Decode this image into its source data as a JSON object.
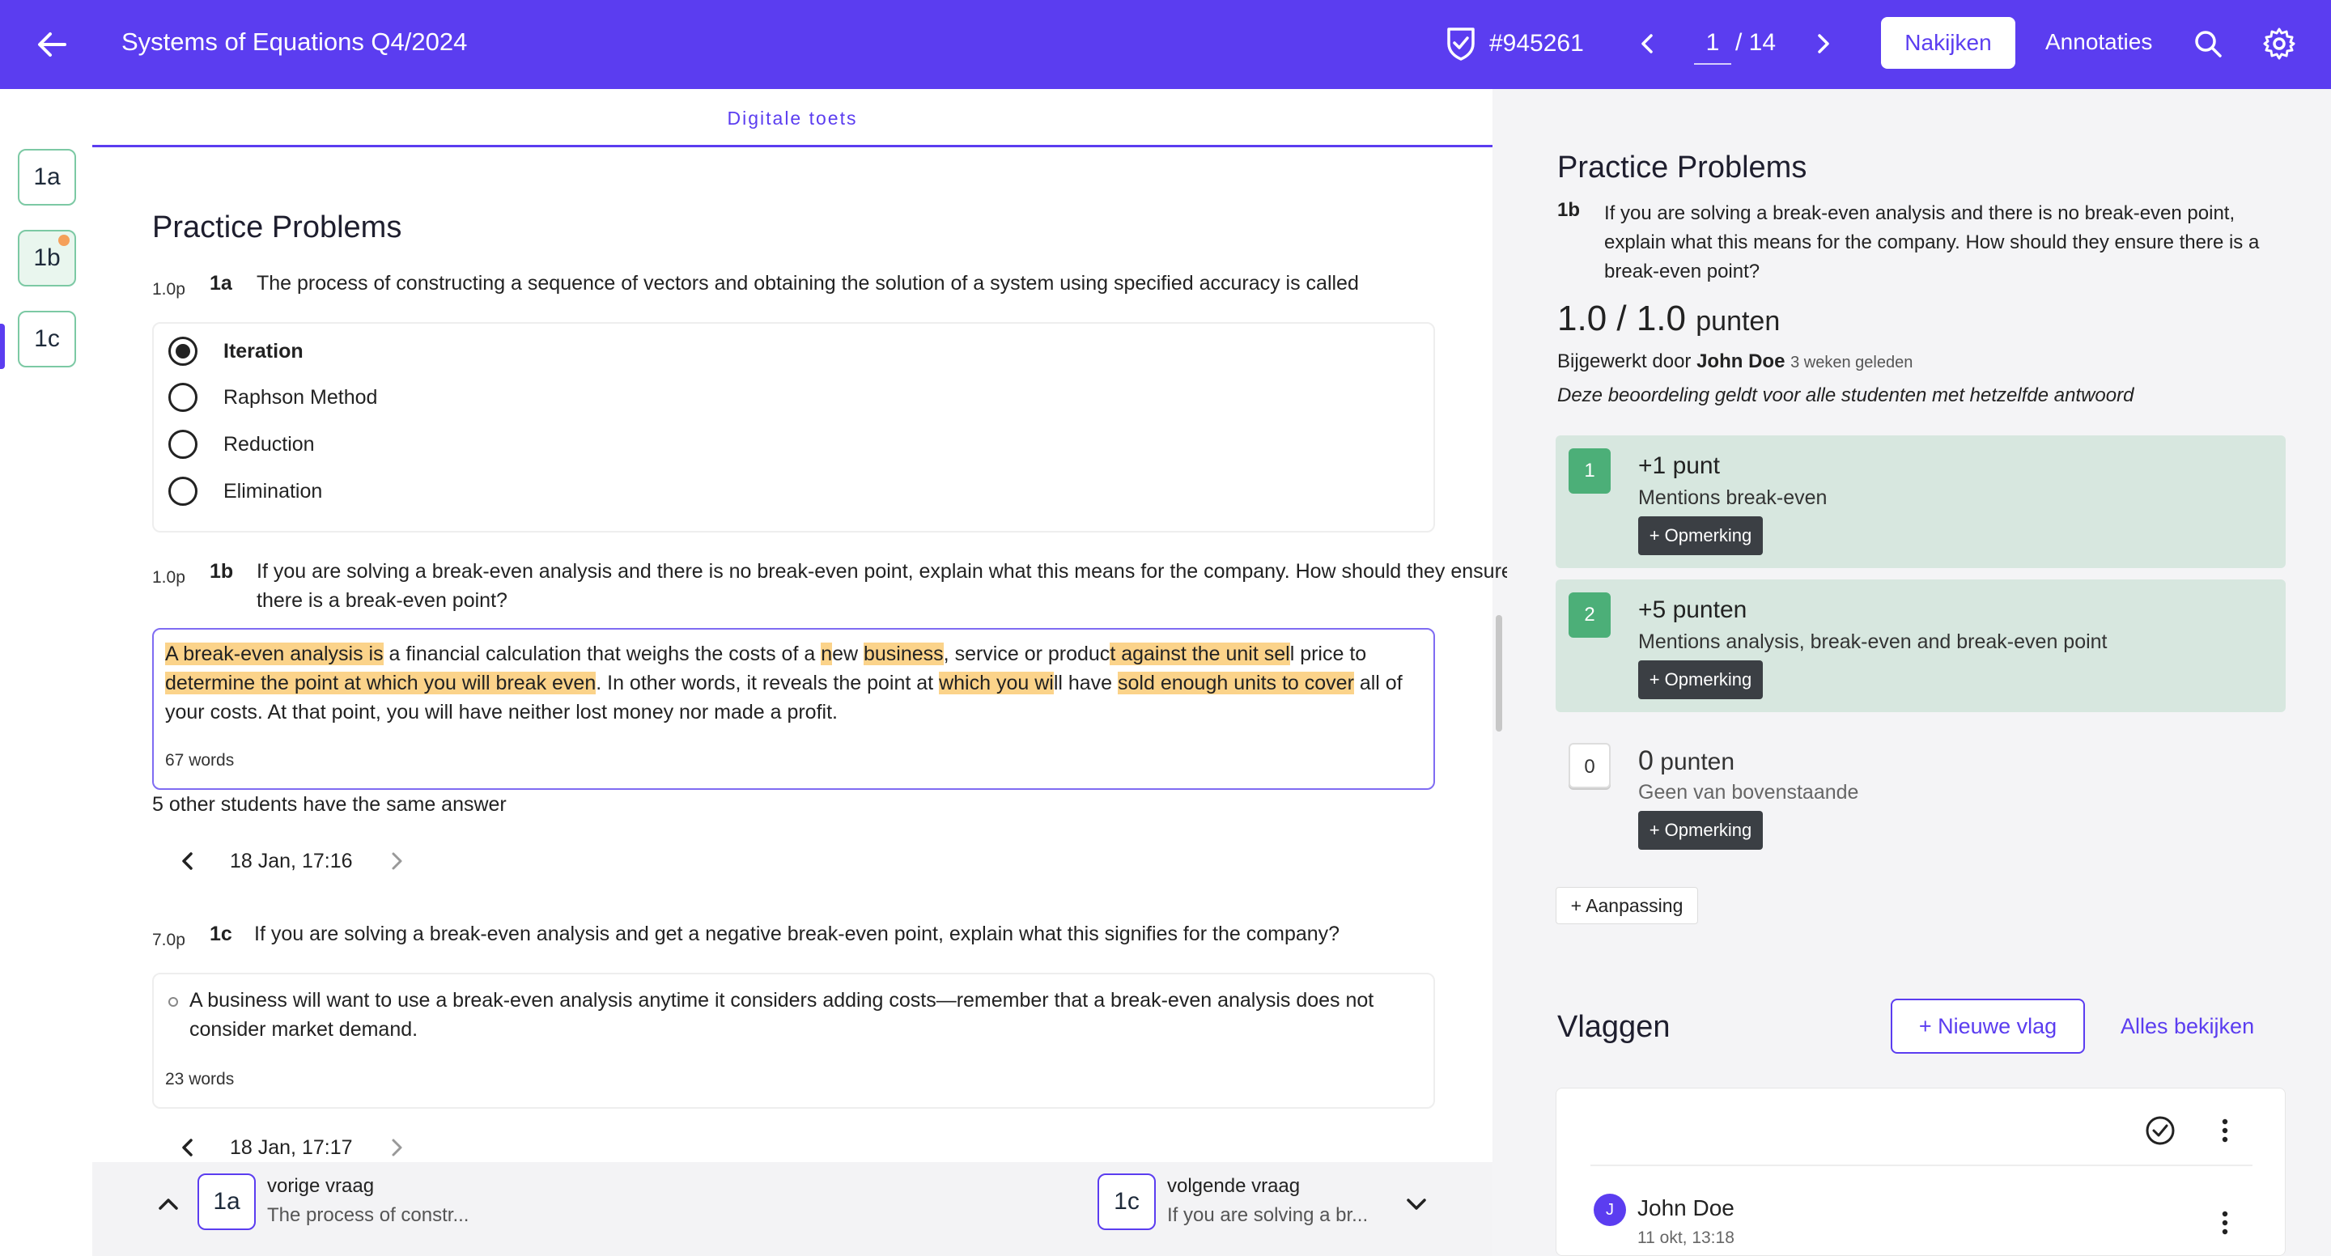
{
  "header": {
    "title": "Systems of Equations Q4/2024",
    "id_label": "#945261",
    "page_current": "1",
    "page_total": "/ 14",
    "nakijken_label": "Nakijken",
    "annotaties_label": "Annotaties"
  },
  "rail": {
    "items": [
      "1a",
      "1b",
      "1c"
    ]
  },
  "main": {
    "tab_label": "Digitale toets",
    "section_title": "Practice Problems",
    "q1a": {
      "points": "1.0p",
      "num": "1a",
      "text": "The process of constructing a sequence of vectors and obtaining the solution of a system using specified accuracy is called",
      "options": [
        "Iteration",
        "Raphson Method",
        "Reduction",
        "Elimination"
      ]
    },
    "q1b": {
      "points": "1.0p",
      "num": "1b",
      "text": "If you are solving a break-even analysis and there is no break-even point, explain what this means for the company. How should they ensure there is a break-even point?",
      "answer_segments": [
        [
          "A break-even analysis is",
          true
        ],
        [
          " a financial calculation that weighs the costs of a ",
          false
        ],
        [
          "n",
          true
        ],
        [
          "ew ",
          false
        ],
        [
          "business",
          true
        ],
        [
          ", service or produc",
          false
        ],
        [
          "t against the unit sel",
          true
        ],
        [
          "l price to ",
          false
        ],
        [
          "determine the point at which you will break even",
          true
        ],
        [
          ". In other words, it reveals the point at ",
          false
        ],
        [
          "which you wi",
          true
        ],
        [
          "ll have ",
          false
        ],
        [
          "sold enough units to cover",
          true
        ],
        [
          " all of your costs. At that point, you will have neither lost money nor made a profit.",
          false
        ]
      ],
      "word_count": "67 words",
      "same_answer": "5 other students have the same answer",
      "date": "18 Jan, 17:16"
    },
    "q1c": {
      "points": "7.0p",
      "num": "1c",
      "text": "If you are solving a break-even analysis and get a negative break-even point, explain what this signifies for the company?",
      "answer": "A business will want to use a break-even analysis anytime it considers adding costs—remember that a break-even analysis does not consider market demand.",
      "word_count": "23 words",
      "date": "18 Jan, 17:17"
    },
    "bottom": {
      "prev_chip": "1a",
      "prev_title": "vorige vraag",
      "prev_sub": "The process of constr...",
      "next_chip": "1c",
      "next_title": "volgende vraag",
      "next_sub": "If you are solving a br..."
    }
  },
  "panel": {
    "title": "Practice Problems",
    "qnum": "1b",
    "qtext": "If you are solving a break-even analysis and there is no break-even point, explain what this means for the company. How should they ensure there is a break-even point?",
    "score": "1.0 / 1.0",
    "score_unit": "punten",
    "updated_prefix": "Bijgewerkt door ",
    "updated_by": "John Doe",
    "updated_ago": "3 weken geleden",
    "note": "Deze beoordeling geldt voor alle studenten met hetzelfde antwoord",
    "criteria": [
      {
        "num": "1",
        "head_value": "+1",
        "head_unit": "punt",
        "desc": "Mentions break-even",
        "btn": "+ Opmerking"
      },
      {
        "num": "2",
        "head_value": "+5",
        "head_unit": "punten",
        "desc": "Mentions analysis, break-even and break-even point",
        "btn": "+ Opmerking"
      },
      {
        "num": "0",
        "head_value": "0",
        "head_unit": "punten",
        "desc": "Geen van bovenstaande",
        "btn": "+ Opmerking"
      }
    ],
    "aanpassing": "+ Aanpassing",
    "flags_title": "Vlaggen",
    "new_flag": "+ Nieuwe vlag",
    "all_flags": "Alles bekijken",
    "flag": {
      "avatar": "J",
      "name": "John Doe",
      "date": "11 okt, 13:18"
    }
  },
  "colors": {
    "brand": "#5b3df0",
    "criterion_bg": "#d7e7df",
    "criterion_num": "#4caf78",
    "highlight": "#fbd38a"
  },
  "icons": [
    "arrow-left-icon",
    "shield-check-icon",
    "chevron-left-icon",
    "chevron-right-icon",
    "search-icon",
    "gear-icon",
    "chevron-up-icon",
    "chevron-down-icon",
    "check-circle-icon",
    "kebab-icon"
  ]
}
